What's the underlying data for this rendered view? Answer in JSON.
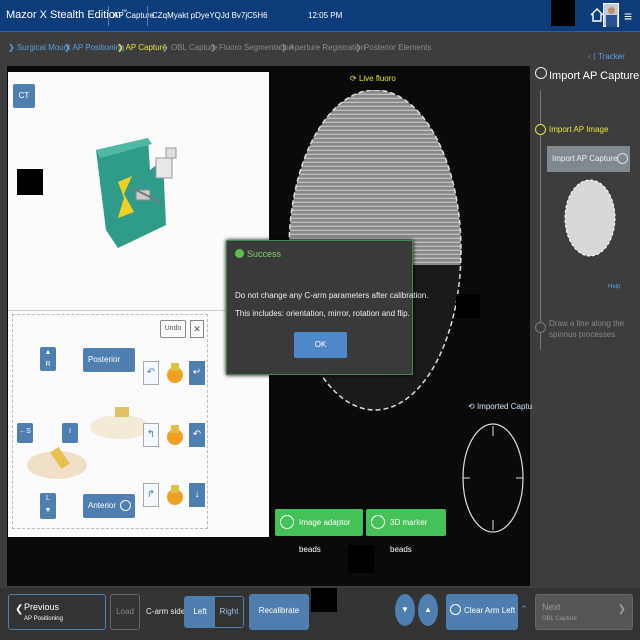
{
  "topbar": {
    "app_title": "Mazor X Stealth Edition",
    "tm": "™",
    "tab_label": "AP Capture",
    "patient_id": "CZqMyakt pDyeYQJd Bv7jC5H6",
    "time": "12:05 PM"
  },
  "breadcrumbs": [
    {
      "label": "Surgical Mount",
      "state": "done"
    },
    {
      "label": "AP Positioning",
      "state": "done"
    },
    {
      "label": "AP Capture",
      "state": "active"
    },
    {
      "label": "OBL Capture",
      "state": "todo"
    },
    {
      "label": "Fluoro Segmentation",
      "state": "todo"
    },
    {
      "label": "Aperture Registration",
      "state": "todo"
    },
    {
      "label": "Posterior Elements",
      "state": "todo"
    }
  ],
  "tracker_label": "Tracker",
  "left_panel": {
    "ct_button": "CT",
    "undo": "Undo",
    "close_x": "✕",
    "arrows": {
      "up": "R",
      "left": "←S",
      "right": "I",
      "down": "L"
    },
    "posterior": "Posterior",
    "anterior": "Anterior"
  },
  "fluoro": {
    "live_label": "Live fluoro",
    "imported_label": "Imported Capture"
  },
  "dialog": {
    "title": "Success",
    "line1": "Do not change any C-arm parameters after calibration.",
    "line2": "This includes: orientation, mirror, rotation and flip.",
    "ok": "OK"
  },
  "green_buttons": {
    "adaptor": "Image adaptor beads",
    "marker": "3D marker beads"
  },
  "side_panel": {
    "title": "Import AP Capture",
    "step1": "Import AP Image",
    "import_button": "Import AP Capture",
    "help": "Help",
    "step2": "Draw a line along the spinous processes"
  },
  "bottom_bar": {
    "previous": "Previous",
    "previous_sub": "AP Positioning",
    "load": "Load",
    "carm_side": "C-arm side:",
    "left": "Left",
    "right": "Right",
    "recalibrate": "Recalibrate",
    "clear_arm": "Clear Arm Left",
    "next": "Next",
    "next_sub": "OBL Capture"
  },
  "colors": {
    "accent": "#4f7fb0",
    "active_step": "#e8e33a",
    "success": "#44c257",
    "topbar": "#0d3c7a"
  }
}
